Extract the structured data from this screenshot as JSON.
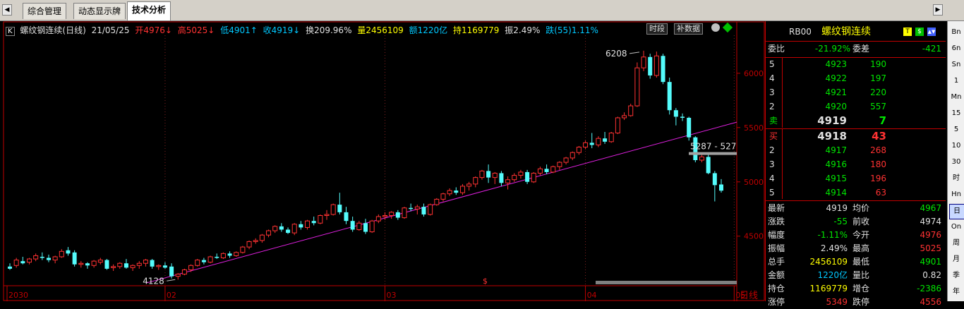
{
  "tabs": {
    "items": [
      "综合管理",
      "动态显示牌",
      "技术分析"
    ],
    "active": 2,
    "left_scroll": "◀",
    "right_scroll": "▶"
  },
  "title_bar": {
    "k_icon": "K",
    "name": "螺纹钢连续(日线)",
    "date": "21/05/25",
    "open": "开4976↓",
    "high": "高5025↓",
    "low": "低4901↑",
    "close": "收4919↓",
    "turnover": "换209.96%",
    "volume": "量2456109",
    "amount": "额1220亿",
    "position": "持1169779",
    "amplitude": "振2.49%",
    "change": "跌(55)1.11%",
    "btn_shiduan": "时段",
    "btn_bushuju": "补数据"
  },
  "chart_data": {
    "type": "candlestick",
    "y_ticks": [
      4500,
      5000,
      5500,
      6000
    ],
    "ylim": [
      4050,
      6350
    ],
    "x_labels": [
      "2030",
      "02",
      "03",
      "04",
      "05"
    ],
    "period_label": "日线",
    "annotations": {
      "high": "6208",
      "low": "4128",
      "level_line": "5287 - 527",
      "marker": "$"
    },
    "trendline": {
      "from": [
        0,
        4070
      ],
      "to": [
        1,
        5550
      ]
    },
    "candles": [
      [
        4220,
        4250,
        4190,
        4200
      ],
      [
        4230,
        4300,
        4210,
        4280
      ],
      [
        4270,
        4310,
        4240,
        4250
      ],
      [
        4260,
        4300,
        4240,
        4290
      ],
      [
        4290,
        4340,
        4270,
        4320
      ],
      [
        4310,
        4350,
        4280,
        4300
      ],
      [
        4300,
        4330,
        4260,
        4280
      ],
      [
        4280,
        4320,
        4250,
        4310
      ],
      [
        4310,
        4380,
        4300,
        4360
      ],
      [
        4370,
        4400,
        4320,
        4340
      ],
      [
        4350,
        4370,
        4220,
        4240
      ],
      [
        4240,
        4270,
        4210,
        4250
      ],
      [
        4250,
        4260,
        4200,
        4230
      ],
      [
        4230,
        4280,
        4210,
        4270
      ],
      [
        4260,
        4300,
        4240,
        4280
      ],
      [
        4280,
        4290,
        4190,
        4200
      ],
      [
        4210,
        4240,
        4180,
        4220
      ],
      [
        4220,
        4260,
        4200,
        4250
      ],
      [
        4250,
        4290,
        4200,
        4210
      ],
      [
        4210,
        4240,
        4180,
        4230
      ],
      [
        4230,
        4270,
        4200,
        4250
      ],
      [
        4250,
        4290,
        4220,
        4280
      ],
      [
        4280,
        4290,
        4200,
        4220
      ],
      [
        4220,
        4240,
        4190,
        4230
      ],
      [
        4230,
        4260,
        4200,
        4210
      ],
      [
        4220,
        4250,
        4110,
        4130
      ],
      [
        4130,
        4160,
        4100,
        4150
      ],
      [
        4150,
        4200,
        4140,
        4190
      ],
      [
        4190,
        4240,
        4170,
        4230
      ],
      [
        4230,
        4290,
        4220,
        4280
      ],
      [
        4280,
        4300,
        4240,
        4260
      ],
      [
        4260,
        4320,
        4250,
        4310
      ],
      [
        4310,
        4340,
        4290,
        4300
      ],
      [
        4300,
        4350,
        4290,
        4340
      ],
      [
        4340,
        4360,
        4300,
        4320
      ],
      [
        4320,
        4360,
        4310,
        4350
      ],
      [
        4350,
        4410,
        4340,
        4400
      ],
      [
        4400,
        4460,
        4380,
        4450
      ],
      [
        4450,
        4480,
        4430,
        4460
      ],
      [
        4460,
        4520,
        4440,
        4510
      ],
      [
        4510,
        4560,
        4490,
        4550
      ],
      [
        4550,
        4600,
        4530,
        4590
      ],
      [
        4590,
        4620,
        4540,
        4560
      ],
      [
        4560,
        4580,
        4520,
        4530
      ],
      [
        4530,
        4620,
        4510,
        4610
      ],
      [
        4610,
        4640,
        4560,
        4580
      ],
      [
        4580,
        4650,
        4560,
        4640
      ],
      [
        4640,
        4680,
        4600,
        4620
      ],
      [
        4620,
        4700,
        4610,
        4690
      ],
      [
        4690,
        4740,
        4650,
        4700
      ],
      [
        4700,
        4800,
        4690,
        4790
      ],
      [
        4790,
        4900,
        4700,
        4720
      ],
      [
        4720,
        4770,
        4610,
        4640
      ],
      [
        4640,
        4680,
        4540,
        4560
      ],
      [
        4560,
        4640,
        4550,
        4620
      ],
      [
        4620,
        4660,
        4520,
        4540
      ],
      [
        4540,
        4650,
        4530,
        4640
      ],
      [
        4640,
        4700,
        4620,
        4680
      ],
      [
        4680,
        4720,
        4650,
        4690
      ],
      [
        4690,
        4730,
        4660,
        4720
      ],
      [
        4720,
        4740,
        4650,
        4670
      ],
      [
        4670,
        4770,
        4660,
        4760
      ],
      [
        4760,
        4800,
        4730,
        4750
      ],
      [
        4750,
        4790,
        4700,
        4770
      ],
      [
        4770,
        4800,
        4680,
        4700
      ],
      [
        4700,
        4800,
        4690,
        4790
      ],
      [
        4790,
        4850,
        4780,
        4840
      ],
      [
        4840,
        4900,
        4820,
        4890
      ],
      [
        4890,
        4940,
        4870,
        4920
      ],
      [
        4920,
        4950,
        4880,
        4900
      ],
      [
        4900,
        4980,
        4880,
        4960
      ],
      [
        4960,
        5000,
        4920,
        4980
      ],
      [
        4980,
        5050,
        4950,
        5040
      ],
      [
        5040,
        5110,
        5020,
        5100
      ],
      [
        5100,
        5160,
        4990,
        5040
      ],
      [
        5040,
        5090,
        4980,
        5080
      ],
      [
        5080,
        5100,
        4960,
        4990
      ],
      [
        4990,
        5050,
        4930,
        5020
      ],
      [
        5020,
        5080,
        5000,
        5060
      ],
      [
        5060,
        5110,
        5030,
        5090
      ],
      [
        5090,
        5110,
        4980,
        5000
      ],
      [
        5000,
        5090,
        4990,
        5080
      ],
      [
        5080,
        5140,
        5060,
        5120
      ],
      [
        5120,
        5160,
        5070,
        5090
      ],
      [
        5090,
        5150,
        5080,
        5140
      ],
      [
        5140,
        5190,
        5110,
        5180
      ],
      [
        5180,
        5230,
        5160,
        5220
      ],
      [
        5220,
        5280,
        5200,
        5270
      ],
      [
        5270,
        5330,
        5250,
        5320
      ],
      [
        5320,
        5380,
        5300,
        5360
      ],
      [
        5360,
        5450,
        5310,
        5340
      ],
      [
        5340,
        5420,
        5320,
        5400
      ],
      [
        5400,
        5460,
        5350,
        5370
      ],
      [
        5370,
        5460,
        5360,
        5450
      ],
      [
        5450,
        5600,
        5440,
        5590
      ],
      [
        5590,
        5640,
        5570,
        5610
      ],
      [
        5610,
        5720,
        5600,
        5700
      ],
      [
        5700,
        6100,
        5690,
        6050
      ],
      [
        6050,
        6208,
        6020,
        6150
      ],
      [
        6150,
        6180,
        5950,
        5980
      ],
      [
        5980,
        6200,
        5960,
        6160
      ],
      [
        6160,
        6180,
        5900,
        5920
      ],
      [
        5920,
        5960,
        5620,
        5660
      ],
      [
        5660,
        5680,
        5520,
        5600
      ],
      [
        5600,
        5630,
        5560,
        5590
      ],
      [
        5590,
        5600,
        5380,
        5410
      ],
      [
        5410,
        5420,
        5180,
        5200
      ],
      [
        5200,
        5250,
        5180,
        5230
      ],
      [
        5230,
        5260,
        5070,
        5080
      ],
      [
        5080,
        5100,
        4820,
        4970
      ],
      [
        4976,
        5025,
        4901,
        4919
      ]
    ]
  },
  "right_panel": {
    "header": {
      "code": "RB00",
      "name": "螺纹钢连续",
      "icon_t": "T",
      "icon_s": "$",
      "icon_d": "▲▼"
    },
    "webi": {
      "label": "委比",
      "value": "-21.92%",
      "label2": "委差",
      "value2": "-421"
    },
    "sell_levels": [
      {
        "lvl": "5",
        "price": "4923",
        "vol": "190"
      },
      {
        "lvl": "4",
        "price": "4922",
        "vol": "197"
      },
      {
        "lvl": "3",
        "price": "4921",
        "vol": "220"
      },
      {
        "lvl": "2",
        "price": "4920",
        "vol": "557"
      },
      {
        "lvl": "卖",
        "price": "4919",
        "vol": "7"
      }
    ],
    "buy_levels": [
      {
        "lvl": "买",
        "price": "4918",
        "vol": "43"
      },
      {
        "lvl": "2",
        "price": "4917",
        "vol": "268"
      },
      {
        "lvl": "3",
        "price": "4916",
        "vol": "180"
      },
      {
        "lvl": "4",
        "price": "4915",
        "vol": "196"
      },
      {
        "lvl": "5",
        "price": "4914",
        "vol": "63"
      }
    ],
    "stats": [
      {
        "l1": "最新",
        "v1": "4919",
        "l2": "均价",
        "v2": "4967"
      },
      {
        "l1": "涨跌",
        "v1": "-55",
        "l2": "前收",
        "v2": "4974"
      },
      {
        "l1": "幅度",
        "v1": "-1.11%",
        "l2": "今开",
        "v2": "4976"
      },
      {
        "l1": "振幅",
        "v1": "2.49%",
        "l2": "最高",
        "v2": "5025"
      },
      {
        "l1": "总手",
        "v1": "2456109",
        "l2": "最低",
        "v2": "4901"
      },
      {
        "l1": "金额",
        "v1": "1220亿",
        "l2": "量比",
        "v2": "0.82"
      },
      {
        "l1": "持仓",
        "v1": "1169779",
        "l2": "增仓",
        "v2": "-2386"
      },
      {
        "l1": "涨停",
        "v1": "5349",
        "l2": "跌停",
        "v2": "4556"
      }
    ]
  },
  "period_toolbar": {
    "items": [
      "1m",
      "5m",
      "15m",
      "30m",
      "60m",
      "4h",
      "日",
      "周",
      "月",
      "季",
      "年"
    ],
    "labels": [
      "Bn",
      "6n",
      "Sn",
      "1",
      "Mn",
      "15",
      "5",
      "10",
      "30",
      "时",
      "Hn",
      "日",
      "On",
      "周",
      "月",
      "季",
      "年"
    ],
    "selected": 11
  }
}
